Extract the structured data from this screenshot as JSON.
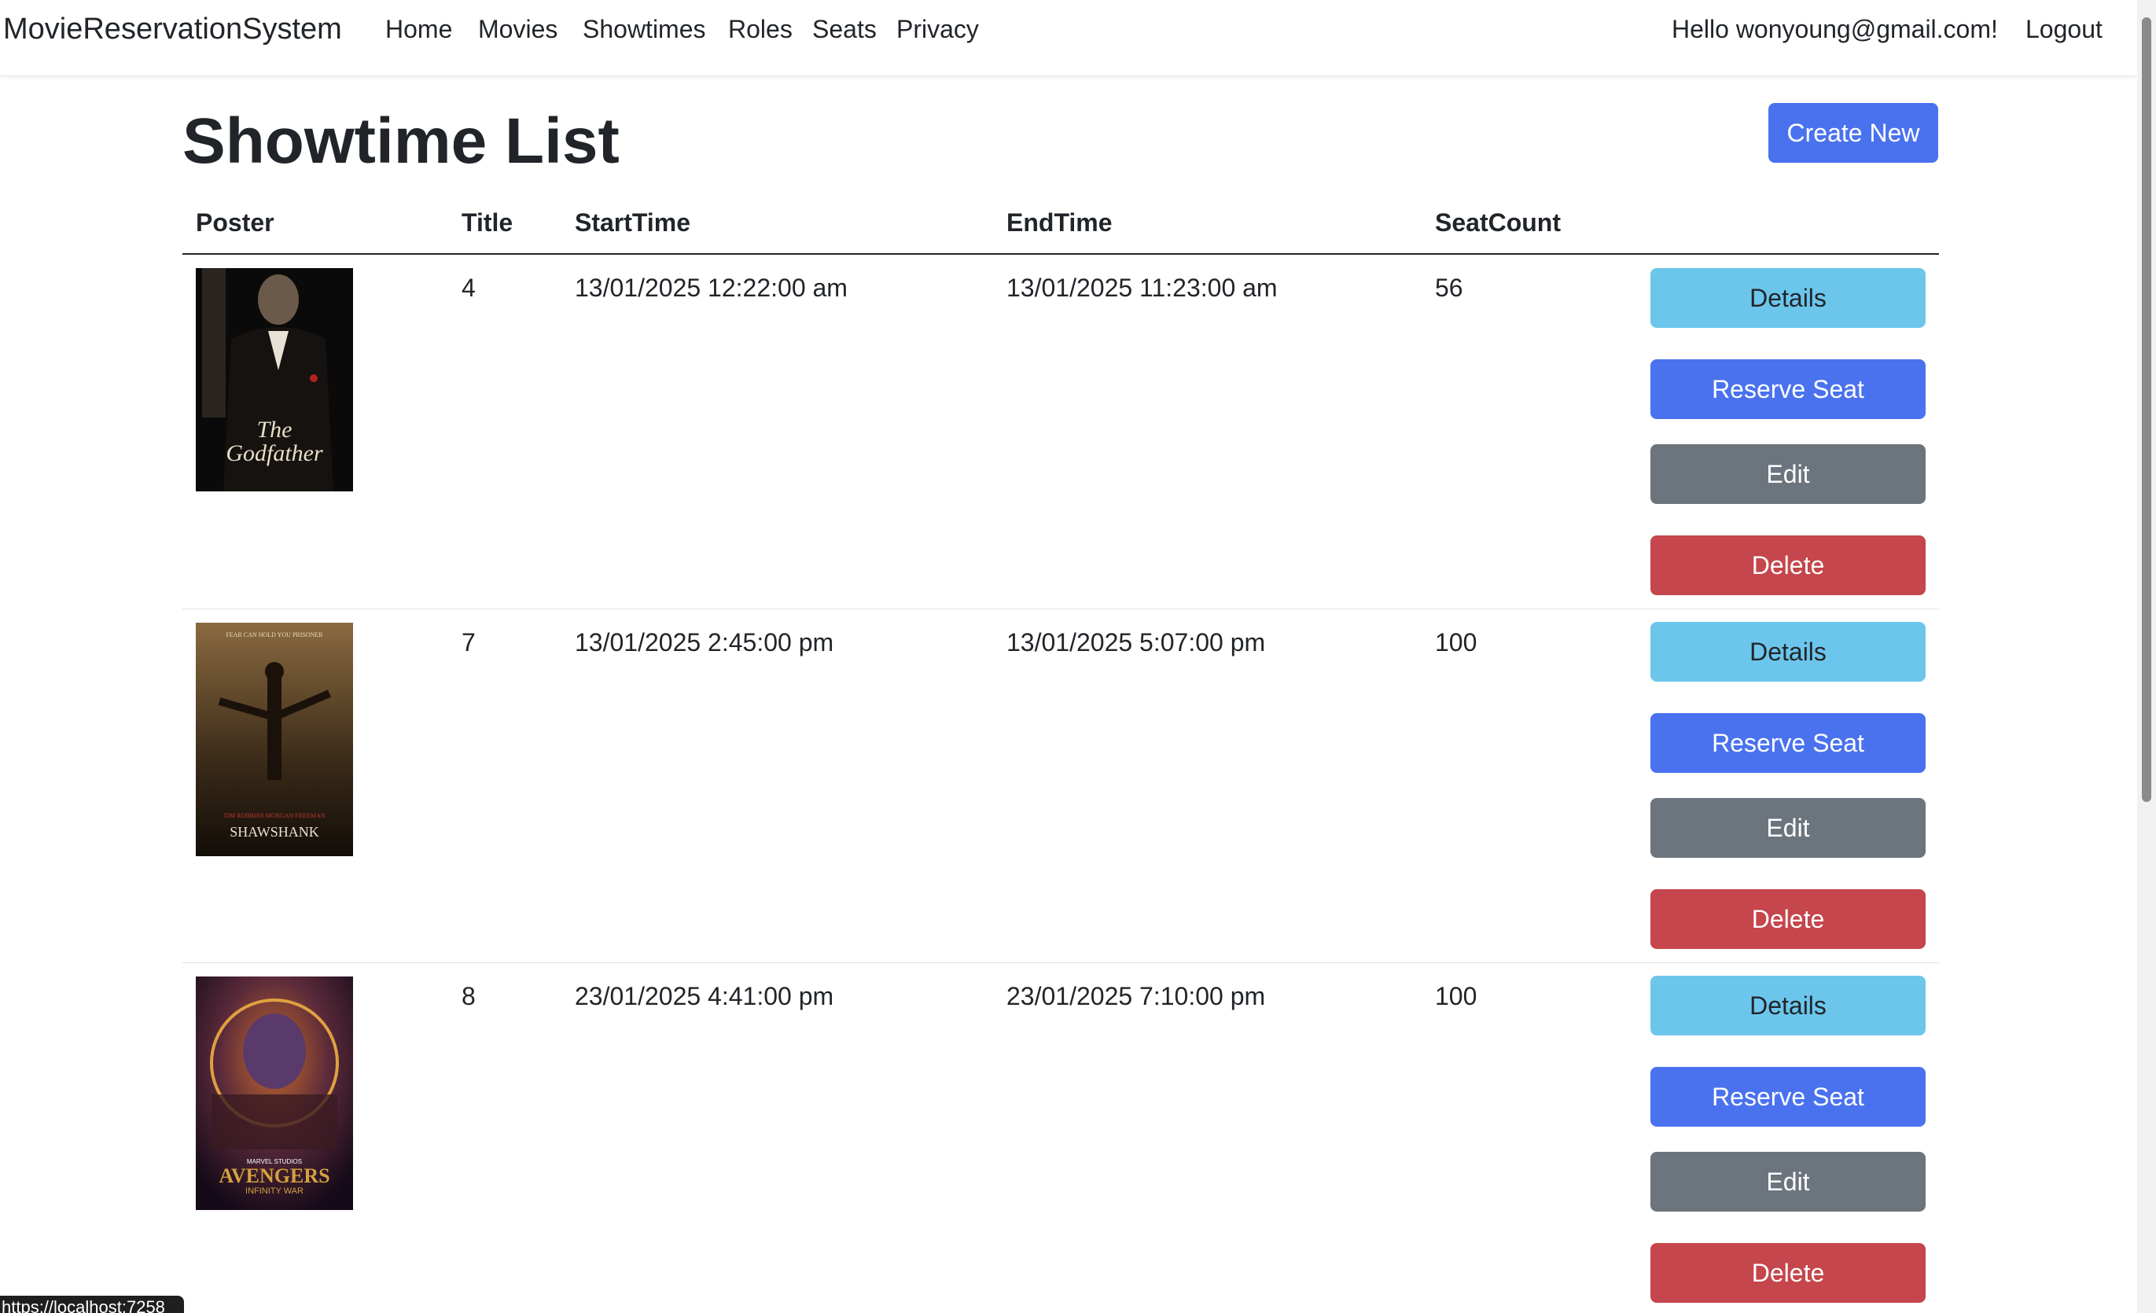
{
  "navbar": {
    "brand": "MovieReservationSystem",
    "items": [
      "Home",
      "Movies",
      "Showtimes",
      "Roles",
      "Seats",
      "Privacy"
    ],
    "greeting": "Hello wonyoung@gmail.com!",
    "logout": "Logout"
  },
  "page": {
    "title": "Showtime List",
    "create_button": "Create New"
  },
  "table": {
    "headers": [
      "Poster",
      "Title",
      "StartTime",
      "EndTime",
      "SeatCount"
    ],
    "rows": [
      {
        "poster_icon": "godfather-poster",
        "title": "4",
        "start": "13/01/2025 12:22:00 am",
        "end": "13/01/2025 11:23:00 am",
        "seats": "56"
      },
      {
        "poster_icon": "shawshank-poster",
        "title": "7",
        "start": "13/01/2025 2:45:00 pm",
        "end": "13/01/2025 5:07:00 pm",
        "seats": "100"
      },
      {
        "poster_icon": "avengers-poster",
        "title": "8",
        "start": "23/01/2025 4:41:00 pm",
        "end": "23/01/2025 7:10:00 pm",
        "seats": "100"
      }
    ],
    "actions": {
      "details": "Details",
      "reserve": "Reserve Seat",
      "edit": "Edit",
      "delete": "Delete"
    }
  },
  "status_bar": {
    "url": "https://localhost:7258"
  },
  "colors": {
    "primary": "#4a72ef",
    "info": "#6cc6ec",
    "secondary": "#6c757d",
    "danger": "#c5464c"
  }
}
